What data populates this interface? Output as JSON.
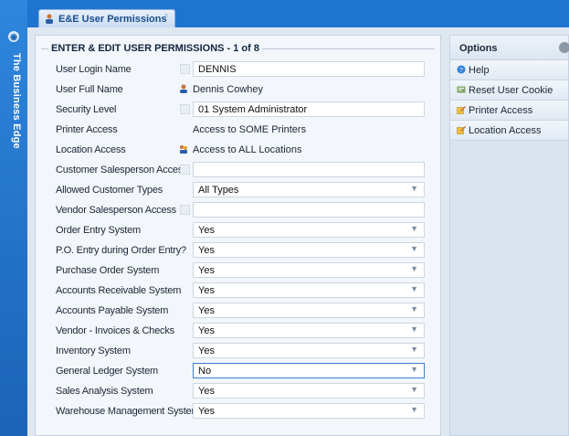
{
  "app": {
    "brand": "The Business Edge",
    "tab_title": "E&E User Permissions",
    "tab_close": "×"
  },
  "form": {
    "legend": "ENTER & EDIT USER PERMISSIONS - 1 of 8",
    "rows": [
      {
        "label": "User Login Name",
        "value": "DENNIS",
        "kind": "input"
      },
      {
        "label": "User Full Name",
        "value": "Dennis Cowhey",
        "kind": "text"
      },
      {
        "label": "Security Level",
        "value": "01 System Administrator",
        "kind": "input"
      },
      {
        "label": "Printer Access",
        "value": "Access to SOME Printers",
        "kind": "text"
      },
      {
        "label": "Location Access",
        "value": "Access to ALL Locations",
        "kind": "text"
      },
      {
        "label": "Customer Salesperson Access",
        "value": "",
        "kind": "input"
      },
      {
        "label": "Allowed Customer Types",
        "value": "All Types",
        "kind": "select"
      },
      {
        "label": "Vendor Salesperson Access",
        "value": "",
        "kind": "input"
      },
      {
        "label": "Order Entry System",
        "value": "Yes",
        "kind": "select"
      },
      {
        "label": "P.O. Entry during Order Entry?",
        "value": "Yes",
        "kind": "select"
      },
      {
        "label": "Purchase Order System",
        "value": "Yes",
        "kind": "select"
      },
      {
        "label": "Accounts Receivable System",
        "value": "Yes",
        "kind": "select"
      },
      {
        "label": "Accounts Payable System",
        "value": "Yes",
        "kind": "select"
      },
      {
        "label": "Vendor - Invoices & Checks",
        "value": "Yes",
        "kind": "select"
      },
      {
        "label": "Inventory System",
        "value": "Yes",
        "kind": "select"
      },
      {
        "label": "General Ledger System",
        "value": "No",
        "kind": "select"
      },
      {
        "label": "Sales Analysis System",
        "value": "Yes",
        "kind": "select"
      },
      {
        "label": "Warehouse Management System",
        "value": "Yes",
        "kind": "select"
      }
    ]
  },
  "options": {
    "title": "Options",
    "items": [
      {
        "label": "Help",
        "icon": "help-icon"
      },
      {
        "label": "Reset User Cookie",
        "icon": "reset-cookie-icon"
      },
      {
        "label": "Printer Access",
        "icon": "edit-icon"
      },
      {
        "label": "Location Access",
        "icon": "edit-icon"
      }
    ]
  },
  "colors": {
    "accent": "#1f6fc6",
    "panel": "#f3f6fa",
    "active_border": "#3b7fd0"
  }
}
